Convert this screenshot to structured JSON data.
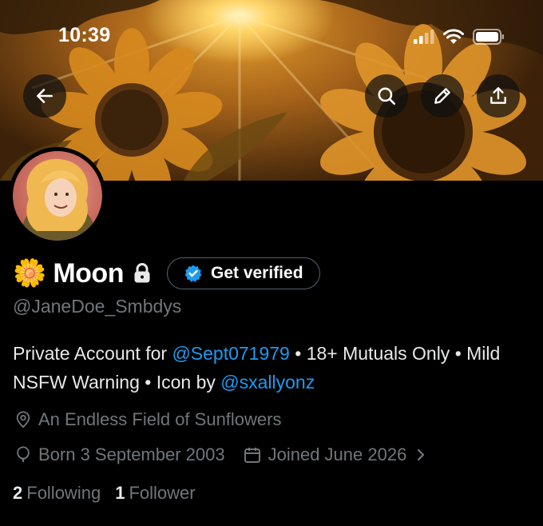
{
  "status_bar": {
    "time": "10:39"
  },
  "header": {
    "icons": [
      "back-arrow-icon",
      "search-icon",
      "pencil-icon",
      "share-icon"
    ]
  },
  "profile": {
    "emoji": "🌼",
    "display_name": "Moon",
    "verify_label": "Get verified",
    "handle": "@JaneDoe_Smbdys",
    "bio": {
      "part1": "Private Account for ",
      "mention1": "@Sept071979",
      "part2": " • 18+ Mutuals Only • Mild NSFW Warning • Icon by ",
      "mention2": "@sxallyonz"
    },
    "location": "An Endless Field of Sunflowers",
    "birthday": "Born 3 September 2003",
    "joined": "Joined June 2026",
    "following_count": "2",
    "following_label": "Following",
    "followers_count": "1",
    "followers_label": "Follower"
  },
  "colors": {
    "accent": "#1d9bf0",
    "muted": "#71767b",
    "text": "#e7e9ea",
    "background": "#000000"
  }
}
